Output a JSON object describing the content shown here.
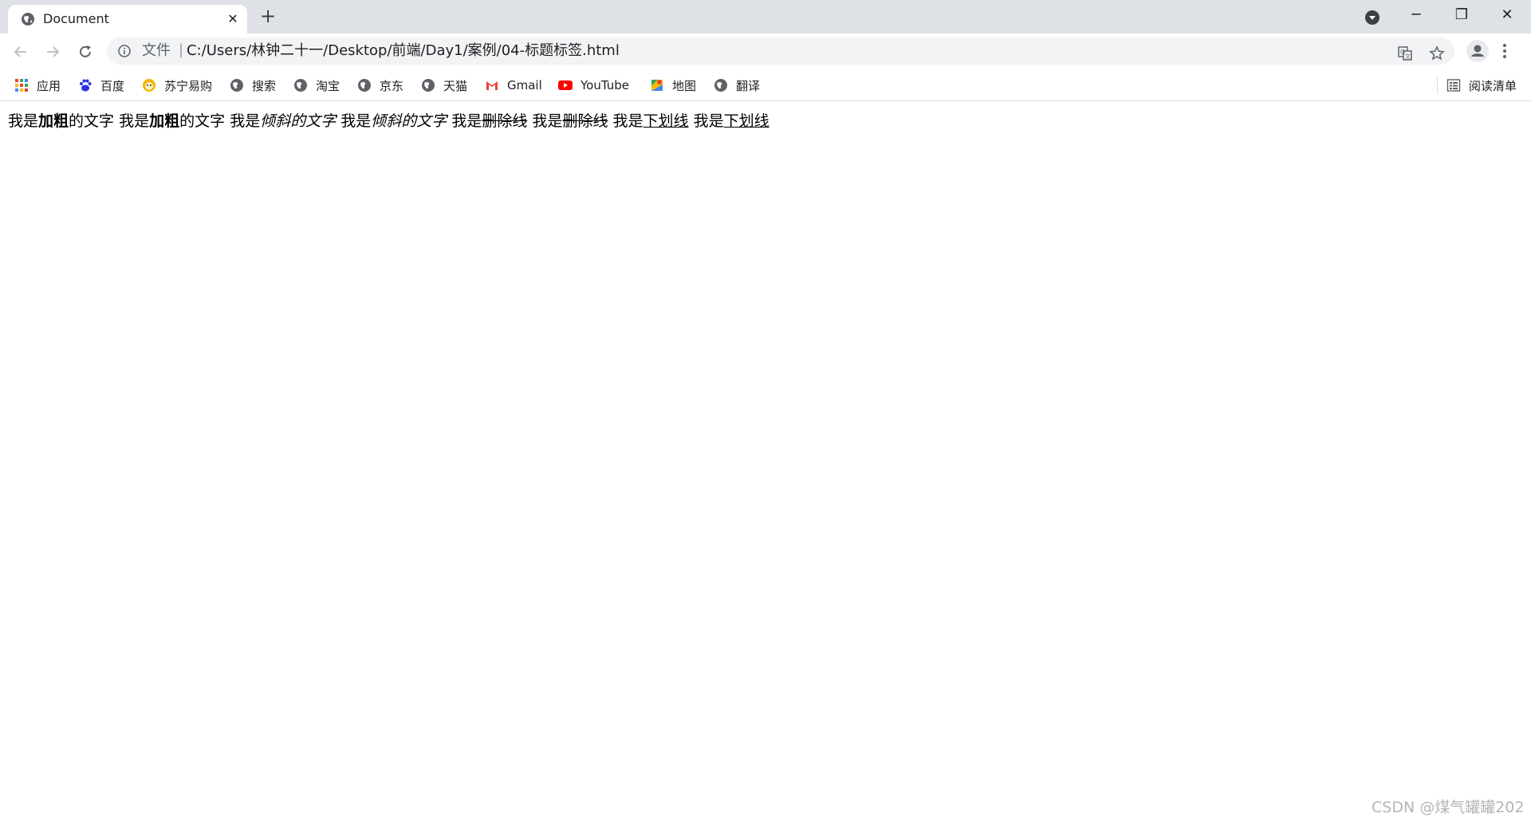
{
  "window": {
    "tab_title": "Document",
    "tab_close": "✕",
    "new_tab": "+",
    "minimize": "─",
    "restore": "❐",
    "close": "✕"
  },
  "toolbar": {
    "scheme_label": "文件",
    "separator": "|",
    "url": "C:/Users/林钟二十一/Desktop/前端/Day1/案例/04-标题标签.html"
  },
  "bookmarks": {
    "items": [
      {
        "label": "应用",
        "icon": "apps-grid-icon"
      },
      {
        "label": "百度",
        "icon": "baidu-paw-icon"
      },
      {
        "label": "苏宁易购",
        "icon": "suning-lion-icon"
      },
      {
        "label": "搜索",
        "icon": "globe-icon"
      },
      {
        "label": "淘宝",
        "icon": "globe-icon"
      },
      {
        "label": "京东",
        "icon": "globe-icon"
      },
      {
        "label": "天猫",
        "icon": "globe-icon"
      },
      {
        "label": "Gmail",
        "icon": "gmail-icon"
      },
      {
        "label": "YouTube",
        "icon": "youtube-icon"
      },
      {
        "label": "地图",
        "icon": "maps-icon"
      },
      {
        "label": "翻译",
        "icon": "globe-icon"
      }
    ],
    "reading_list": "阅读清单"
  },
  "content": {
    "p1_a": "我是",
    "p1_b": "加粗",
    "p1_c": "的文字",
    "p2_a": "我是",
    "p2_b": "加粗",
    "p2_c": "的文字",
    "p3_a": "我是",
    "p3_b": "倾斜的文字",
    "p4_a": "我是",
    "p4_b": "倾斜的文字",
    "p5_a": "我是",
    "p5_b": "删除线",
    "p6_a": "我是",
    "p6_b": "删除线",
    "p7_a": "我是",
    "p7_b": "下划线",
    "p8_a": "我是",
    "p8_b": "下划线"
  },
  "watermark": "CSDN @煤气罐罐202",
  "colors": {
    "tabstrip": "#dee1e6",
    "omnibox": "#f1f3f4",
    "youtube_red": "#ff0000"
  }
}
